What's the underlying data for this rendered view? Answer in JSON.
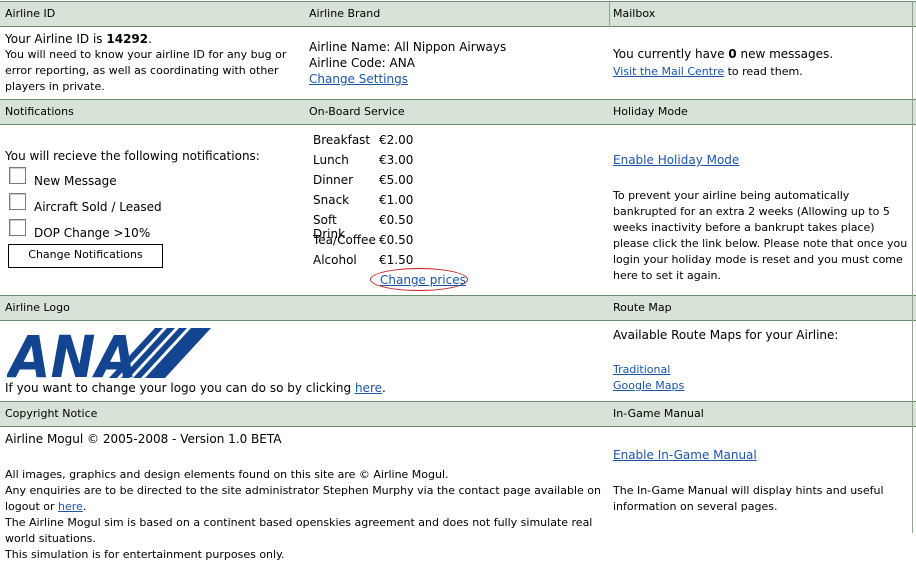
{
  "headers": {
    "airline_id": "Airline ID",
    "airline_brand": "Airline Brand",
    "mailbox": "Mailbox",
    "notifications": "Notifications",
    "onboard": "On-Board Service",
    "holiday": "Holiday Mode",
    "logo": "Airline Logo",
    "route_map": "Route Map",
    "copyright": "Copyright Notice",
    "manual": "In-Game Manual"
  },
  "airline_id": {
    "prefix": "Your Airline ID is ",
    "id": "14292",
    "suffix": ".",
    "desc": "You will need to know your airline ID for any bug or error reporting, as well as coordinating with other players in private."
  },
  "brand": {
    "name_label": "Airline Name: ",
    "name": "All Nippon Airways",
    "code_label": "Airline Code: ",
    "code": "ANA",
    "change_link": "Change Settings"
  },
  "mailbox": {
    "pre": "You currently have ",
    "count": "0",
    "post": " new messages.",
    "link": "Visit the Mail Centre",
    "link_post": " to read them."
  },
  "notifications": {
    "intro": "You will recieve the following notifications:",
    "items": [
      "New Message",
      "Aircraft Sold / Leased",
      "DOP Change >10%"
    ],
    "button": "Change Notifications"
  },
  "onboard": {
    "items": [
      {
        "name": "Breakfast",
        "price": "€2.00"
      },
      {
        "name": "Lunch",
        "price": "€3.00"
      },
      {
        "name": "Dinner",
        "price": "€5.00"
      },
      {
        "name": "Snack",
        "price": "€1.00"
      },
      {
        "name": "Soft Drink",
        "price": "€0.50"
      },
      {
        "name": "Tea/Coffee",
        "price": "€0.50"
      },
      {
        "name": "Alcohol",
        "price": "€1.50"
      }
    ],
    "change_link": "Change prices"
  },
  "holiday": {
    "link": "Enable Holiday Mode",
    "desc": "To prevent your airline being automatically bankrupted for an extra 2 weeks (Allowing up to 5 weeks inactivity before a bankrupt takes place) please click the link below. Please note that once you login your holiday mode is reset and you must come here to set it again."
  },
  "logo": {
    "logo_text": "ANA",
    "pre": "If you want to change your logo you can do so by clicking ",
    "link": "here",
    "post": ".",
    "brand_color": "#13448f"
  },
  "route_map": {
    "intro": "Available Route Maps for your Airline:",
    "links": [
      "Traditional",
      "Google Maps"
    ]
  },
  "copyright": {
    "line": "Airline Mogul © 2005-2008 - Version 1.0 BETA",
    "p1": "All images, graphics and design elements found on this site are © Airline Mogul.",
    "p2_pre": "Any enquiries are to be directed to the site administrator Stephen Murphy via the contact page available on logout or ",
    "p2_link": "here",
    "p2_post": ".",
    "p3": "The Airline Mogul sim is based on a continent based openskies agreement and does not fully simulate real world situations.",
    "p4": "This simulation is for entertainment purposes only."
  },
  "manual": {
    "link": "Enable In-Game Manual",
    "desc": "The In-Game Manual will display hints and useful information on several pages."
  }
}
